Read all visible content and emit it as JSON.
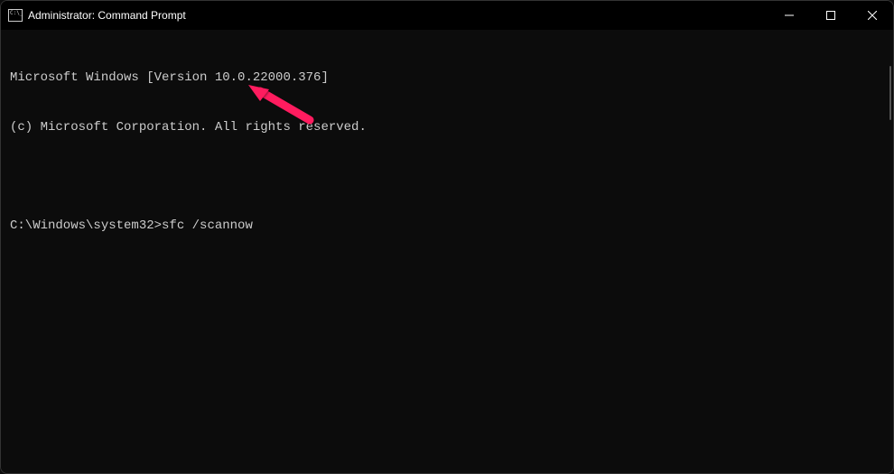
{
  "titlebar": {
    "title": "Administrator: Command Prompt"
  },
  "terminal": {
    "line1": "Microsoft Windows [Version 10.0.22000.376]",
    "line2": "(c) Microsoft Corporation. All rights reserved.",
    "prompt": "C:\\Windows\\system32>",
    "command": "sfc /scannow"
  },
  "annotation": {
    "arrow_color": "#ff1a5e"
  }
}
